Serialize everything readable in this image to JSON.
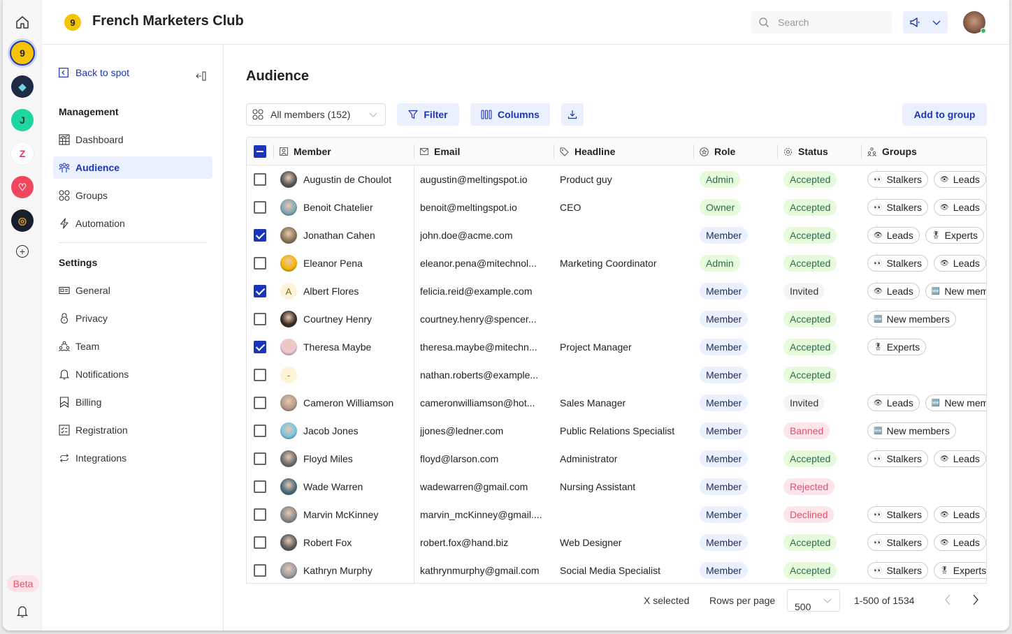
{
  "app": {
    "title": "French Marketers Club",
    "logo_glyph": "9"
  },
  "rail": {
    "spots": [
      {
        "name": "french-marketers-club",
        "color": "#f5c400",
        "glyph": "9",
        "active": true
      },
      {
        "name": "spot-2",
        "color": "#1f2a44",
        "glyph": "◆",
        "active": false
      },
      {
        "name": "spot-3",
        "color": "#1ed6a0",
        "glyph": "J",
        "active": false
      },
      {
        "name": "spot-4",
        "color": "#ffffff",
        "glyph": "Z",
        "active": false
      },
      {
        "name": "spot-5",
        "color": "#f0465e",
        "glyph": "♡",
        "active": false
      },
      {
        "name": "spot-6",
        "color": "#1a1f2e",
        "glyph": "◎",
        "active": false
      }
    ],
    "beta_label": "Beta"
  },
  "header": {
    "search_placeholder": "Search"
  },
  "nav": {
    "back_label": "Back to spot",
    "management_heading": "Management",
    "management_items": [
      {
        "label": "Dashboard",
        "icon": "dashboard-icon",
        "active": false
      },
      {
        "label": "Audience",
        "icon": "audience-icon",
        "active": true
      },
      {
        "label": "Groups",
        "icon": "groups-icon",
        "active": false
      },
      {
        "label": "Automation",
        "icon": "lightning-icon",
        "active": false
      }
    ],
    "settings_heading": "Settings",
    "settings_items": [
      {
        "label": "General",
        "icon": "id-card-icon"
      },
      {
        "label": "Privacy",
        "icon": "lock-icon"
      },
      {
        "label": "Team",
        "icon": "team-icon"
      },
      {
        "label": "Notifications",
        "icon": "bell-icon"
      },
      {
        "label": "Billing",
        "icon": "bookmark-icon"
      },
      {
        "label": "Registration",
        "icon": "checklist-icon"
      },
      {
        "label": "Integrations",
        "icon": "sync-icon"
      }
    ]
  },
  "main": {
    "page_title": "Audience",
    "member_filter": "All members (152)",
    "filter_label": "Filter",
    "columns_label": "Columns",
    "add_to_group_label": "Add to group",
    "columns": {
      "member": "Member",
      "email": "Email",
      "headline": "Headline",
      "role": "Role",
      "status": "Status",
      "groups": "Groups"
    },
    "rows": [
      {
        "checked": false,
        "name": "Augustin de Choulot",
        "email": "augustin@meltingspot.io",
        "headline": "Product guy",
        "role": "Admin",
        "status": "Accepted",
        "groups": [
          "Stalkers",
          "Leads"
        ],
        "avatar": "#555"
      },
      {
        "checked": false,
        "name": "Benoit Chatelier",
        "email": "benoit@meltingspot.io",
        "headline": "CEO",
        "role": "Owner",
        "status": "Accepted",
        "groups": [
          "Stalkers",
          "Leads"
        ],
        "avatar": "#7fa6b3"
      },
      {
        "checked": true,
        "name": "Jonathan Cahen",
        "email": "john.doe@acme.com",
        "headline": "",
        "role": "Member",
        "status": "Accepted",
        "groups": [
          "Leads",
          "Experts"
        ],
        "avatar": "#8b7356"
      },
      {
        "checked": false,
        "name": "Eleanor Pena",
        "email": "eleanor.pena@mitechnol...",
        "headline": "Marketing Coordinator",
        "role": "Admin",
        "status": "Accepted",
        "groups": [
          "Stalkers",
          "Leads"
        ],
        "avatar": "#f2b705"
      },
      {
        "checked": true,
        "name": "Albert Flores",
        "email": "felicia.reid@example.com",
        "headline": "",
        "role": "Member",
        "status": "Invited",
        "groups": [
          "Leads",
          "New members"
        ],
        "avatar": "#fdf3d8",
        "initial": "A"
      },
      {
        "checked": false,
        "name": "Courtney Henry",
        "email": "courtney.henry@spencer...",
        "headline": "",
        "role": "Member",
        "status": "Accepted",
        "groups": [
          "New members"
        ],
        "avatar": "#3a2a22"
      },
      {
        "checked": true,
        "name": "Theresa Maybe",
        "email": "theresa.maybe@mitechn...",
        "headline": "Project Manager",
        "role": "Member",
        "status": "Accepted",
        "groups": [
          "Experts"
        ],
        "avatar": "#f0c6d4"
      },
      {
        "checked": false,
        "name": "",
        "email": "nathan.roberts@example...",
        "headline": "",
        "role": "Member",
        "status": "Accepted",
        "groups": [],
        "avatar": "#fdf3d8",
        "initial": "-"
      },
      {
        "checked": false,
        "name": "Cameron Williamson",
        "email": "cameronwilliamson@hot...",
        "headline": "Sales Manager",
        "role": "Member",
        "status": "Invited",
        "groups": [
          "Leads",
          "New members"
        ],
        "avatar": "#b59a88"
      },
      {
        "checked": false,
        "name": "Jacob Jones",
        "email": "jjones@ledner.com",
        "headline": "Public Relations Specialist",
        "role": "Member",
        "status": "Banned",
        "groups": [
          "New members"
        ],
        "avatar": "#7cc4e0"
      },
      {
        "checked": false,
        "name": "Floyd Miles",
        "email": "floyd@larson.com",
        "headline": "Administrator",
        "role": "Member",
        "status": "Accepted",
        "groups": [
          "Stalkers",
          "Leads"
        ],
        "avatar": "#6b6b6b"
      },
      {
        "checked": false,
        "name": "Wade Warren",
        "email": "wadewarren@gmail.com",
        "headline": "Nursing Assistant",
        "role": "Member",
        "status": "Rejected",
        "groups": [],
        "avatar": "#4a6a7a"
      },
      {
        "checked": false,
        "name": "Marvin McKinney",
        "email": "marvin_mcKinney@gmail....",
        "headline": "",
        "role": "Member",
        "status": "Declined",
        "groups": [
          "Stalkers",
          "Leads"
        ],
        "avatar": "#8a8a8a"
      },
      {
        "checked": false,
        "name": "Robert Fox",
        "email": "robert.fox@hand.biz",
        "headline": "Web Designer",
        "role": "Member",
        "status": "Accepted",
        "groups": [
          "Stalkers",
          "Leads"
        ],
        "avatar": "#5a5a5a"
      },
      {
        "checked": false,
        "name": "Kathryn Murphy",
        "email": "kathrynmurphy@gmail.com",
        "headline": "Social Media Specialist",
        "role": "Member",
        "status": "Accepted",
        "groups": [
          "Stalkers",
          "Experts"
        ],
        "avatar": "#9a9aa0"
      }
    ],
    "group_emoji": {
      "Stalkers": "👀",
      "Leads": "👁",
      "Experts": "🎖",
      "New members": "🆕"
    },
    "footer": {
      "selected_label": "X selected",
      "rows_per_page_label": "Rows per page",
      "rows_per_page_value": "500",
      "range_label": "1-500 of 1534"
    }
  },
  "colors": {
    "accent": "#1a35b8",
    "accent_bg": "#ebf0fe",
    "beta": "#e5536f"
  }
}
